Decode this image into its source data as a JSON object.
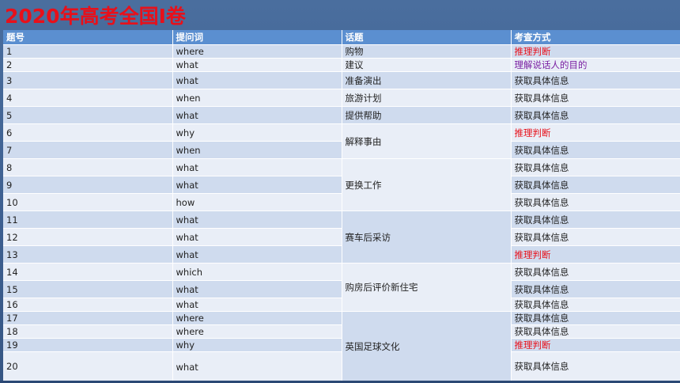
{
  "title": "2020年高考全国I卷",
  "headers": [
    "题号",
    "提问词",
    "话题",
    "考查方式"
  ],
  "colors": {
    "title": "#e8101a",
    "header_bg": "#5b8fd0",
    "infer": "#e8101a",
    "purpose": "#7a1fa2"
  },
  "rows": [
    {
      "num": "1",
      "word": "where",
      "method": "推理判断"
    },
    {
      "num": "2",
      "word": "what",
      "method": "理解说话人的目的"
    },
    {
      "num": "3",
      "word": "what",
      "method": "获取具体信息"
    },
    {
      "num": "4",
      "word": "when",
      "method": "获取具体信息"
    },
    {
      "num": "5",
      "word": "what",
      "method": "获取具体信息"
    },
    {
      "num": "6",
      "word": "why",
      "method": "推理判断"
    },
    {
      "num": "7",
      "word": "when",
      "method": "获取具体信息"
    },
    {
      "num": "8",
      "word": "what",
      "method": "获取具体信息"
    },
    {
      "num": "9",
      "word": "what",
      "method": "获取具体信息"
    },
    {
      "num": "10",
      "word": "how",
      "method": "获取具体信息"
    },
    {
      "num": "11",
      "word": "what",
      "method": "获取具体信息"
    },
    {
      "num": "12",
      "word": "what",
      "method": "获取具体信息"
    },
    {
      "num": "13",
      "word": "what",
      "method": "推理判断"
    },
    {
      "num": "14",
      "word": "which",
      "method": "获取具体信息"
    },
    {
      "num": "15",
      "word": "what",
      "method": "获取具体信息"
    },
    {
      "num": "16",
      "word": "what",
      "method": "获取具体信息"
    },
    {
      "num": "17",
      "word": "where",
      "method": "获取具体信息"
    },
    {
      "num": "18",
      "word": "where",
      "method": "获取具体信息"
    },
    {
      "num": "19",
      "word": "why",
      "method": "推理判断"
    },
    {
      "num": "20",
      "word": "what",
      "method": "获取具体信息"
    }
  ],
  "topics": [
    "购物",
    "建议",
    "准备演出",
    "旅游计划",
    "提供帮助",
    "解释事由",
    "更换工作",
    "赛车后采访",
    "购房后评价新住宅",
    "英国足球文化"
  ]
}
